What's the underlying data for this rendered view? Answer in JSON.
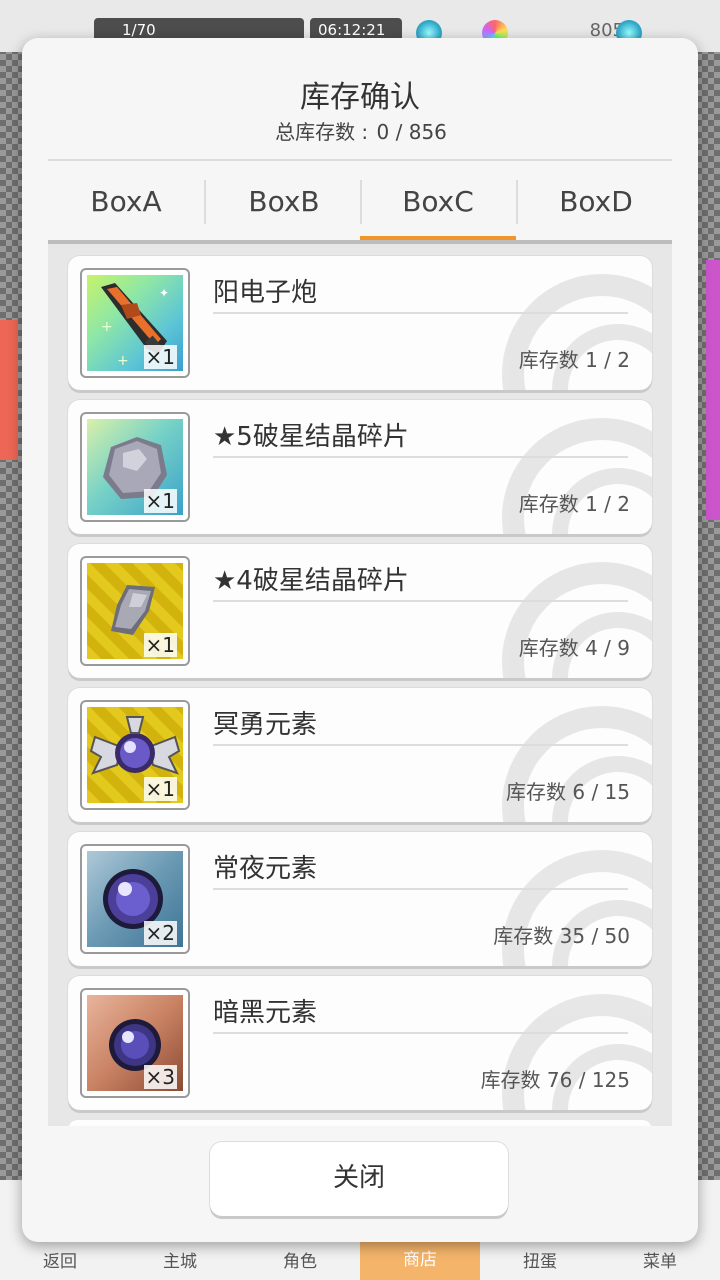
{
  "background": {
    "topbar": {
      "field1": "1/70",
      "field2": "06:12:21",
      "count": "805"
    },
    "nav": [
      "返回",
      "主城",
      "角色",
      "商店",
      "扭蛋",
      "菜单"
    ]
  },
  "dialog": {
    "title": "库存确认",
    "subtitle_label": "总库存数 :",
    "subtitle_value": "0 / 856",
    "tabs": [
      "BoxA",
      "BoxB",
      "BoxC",
      "BoxD"
    ],
    "active_tab": "BoxC",
    "items": [
      {
        "name": "阳电子炮",
        "qty": "×1",
        "stock": "库存数 1 / 2",
        "icon": "positron-cannon-icon"
      },
      {
        "name": "★5破星结晶碎片",
        "qty": "×1",
        "stock": "库存数 1 / 2",
        "icon": "star5-crystal-icon"
      },
      {
        "name": "★4破星结晶碎片",
        "qty": "×1",
        "stock": "库存数 4 / 9",
        "icon": "star4-crystal-icon"
      },
      {
        "name": "冥勇元素",
        "qty": "×1",
        "stock": "库存数 6 / 15",
        "icon": "winged-gem-icon"
      },
      {
        "name": "常夜元素",
        "qty": "×2",
        "stock": "库存数 35 / 50",
        "icon": "night-orb-icon"
      },
      {
        "name": "暗黑元素",
        "qty": "×3",
        "stock": "库存数 76 / 125",
        "icon": "dark-orb-icon"
      }
    ],
    "close_label": "关闭"
  },
  "colors": {
    "accent": "#f0962a",
    "panel": "#f6f6f6",
    "list_bg": "#e7e7e7"
  }
}
